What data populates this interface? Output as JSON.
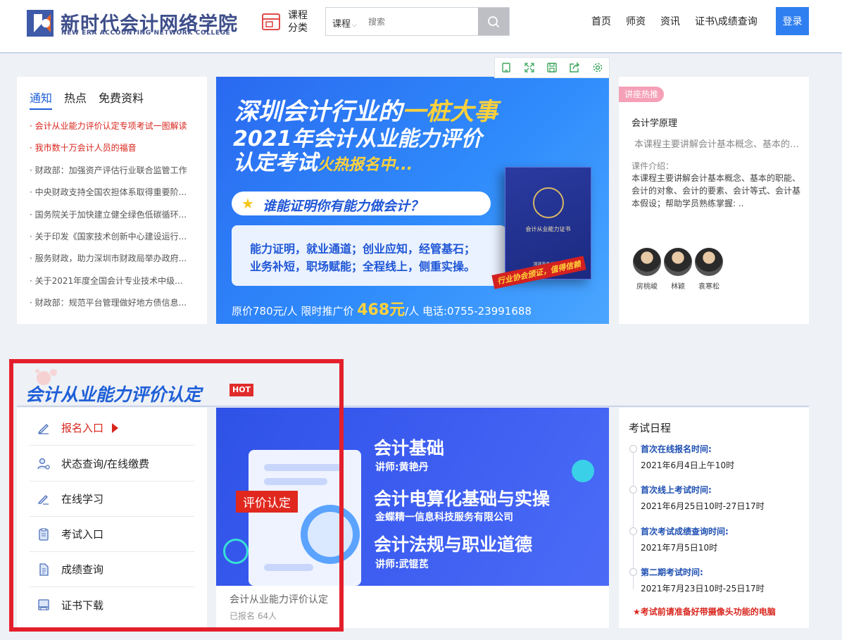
{
  "header": {
    "logo_cn": "新时代会计网络学院",
    "logo_en": "NEW ERA ACCOUNTING NETWORK COLLEGE",
    "category_label": "课程分类",
    "search_type": "课程",
    "search_placeholder": "搜索",
    "nav": [
      "首页",
      "师资",
      "资讯",
      "证书\\成绩查询"
    ],
    "login_label": "登录",
    "brand_color": "#3e4e8a",
    "accent_color": "#2f7ff0"
  },
  "notice": {
    "tabs": [
      "通知",
      "热点",
      "免费资料"
    ],
    "active_tab": 0,
    "items": [
      {
        "text": "· 会计从业能力评价认定专项考试一图解读",
        "highlight": true
      },
      {
        "text": "· 我市数十万会计人员的福音",
        "highlight": true
      },
      {
        "text": "· 财政部：加强资产评估行业联合监管工作",
        "highlight": false
      },
      {
        "text": "· 中央财政支持全国农担体系取得重要阶...",
        "highlight": false
      },
      {
        "text": "· 国务院关于加快建立健全绿色低碳循环...",
        "highlight": false
      },
      {
        "text": "· 关于印发《国家技术创新中心建设运行...",
        "highlight": false
      },
      {
        "text": "· 服务财政，助力深圳市财政局举办政府...",
        "highlight": false
      },
      {
        "text": "· 关于2021年度全国会计专业技术中级...",
        "highlight": false
      },
      {
        "text": "· 财政部：规范平台管理做好地方债信息...",
        "highlight": false
      }
    ]
  },
  "banner": {
    "title1_a": "深圳会计行业的",
    "title1_b": "一桩大事",
    "title2": "2021年会计从业能力评价",
    "title3_a": "认定考试",
    "title3_b": "火热报名中...",
    "question": "谁能证明你有能力做会计？",
    "box_line1": "能力证明，就业通道；创业应知，经管基石；",
    "box_line2": "业务补短，职场赋能；全程线上，侧重实操。",
    "cert_title": "会计从业能力证书",
    "cert_foot": "深圳市会计协会",
    "stamp": "行业协会颁证，值得信赖",
    "price_a": "原价780元/人 限时推广价 ",
    "price_big": "468元",
    "price_b": "/人 电话:0755-23991688"
  },
  "toolbar": {
    "icons": [
      "copy-icon",
      "fullscreen-icon",
      "save-icon",
      "share-icon",
      "settings-icon"
    ]
  },
  "lecture": {
    "tag": "讲座热推",
    "title": "会计学原理",
    "subtitle": "本课程主要讲解会计基本概念、基本的职能",
    "intro_heading": "课件介绍：",
    "intro": "本课程主要讲解会计基本概念、基本的职能、会计的对象、会计的要素、会计等式、会计基本假设；帮助学员熟练掌握: ..",
    "teachers": [
      "房桃峻",
      "林颖",
      "袁寒松"
    ]
  },
  "section": {
    "title": "会计从业能力评价认定",
    "badge": "HOT",
    "menu": [
      {
        "label": "报名入口",
        "icon": "pen-icon",
        "active": true
      },
      {
        "label": "状态查询/在线缴费",
        "icon": "user-settings-icon",
        "active": false
      },
      {
        "label": "在线学习",
        "icon": "edit-icon",
        "active": false
      },
      {
        "label": "考试入口",
        "icon": "clipboard-icon",
        "active": false
      },
      {
        "label": "成绩查询",
        "icon": "document-icon",
        "active": false
      },
      {
        "label": "证书下载",
        "icon": "certificate-icon",
        "active": false
      }
    ]
  },
  "course": {
    "tag": "评价认定",
    "lines": [
      {
        "h": "会计基础",
        "s": "讲师:黄艳丹"
      },
      {
        "h": "会计电算化基础与实操",
        "s": "金蝶精一信息科技服务有限公司"
      },
      {
        "h": "会计法规与职业道德",
        "s": "讲师:武锟芪"
      }
    ],
    "name": "会计从业能力评价认定",
    "count": "已报名 64人"
  },
  "schedule": {
    "title": "考试日程",
    "items": [
      {
        "h": "首次在线报名时间:",
        "d": "2021年6月4日上午10时"
      },
      {
        "h": "首次线上考试时间:",
        "d": "2021年6月25日10时-27日17时"
      },
      {
        "h": "首次考试成绩查询时间:",
        "d": "2021年7月5日10时"
      },
      {
        "h": "第二期考试时间:",
        "d": "2021年7月23日10时-25日17时"
      }
    ],
    "note": "考试前请准备好带摄像头功能的电脑"
  }
}
